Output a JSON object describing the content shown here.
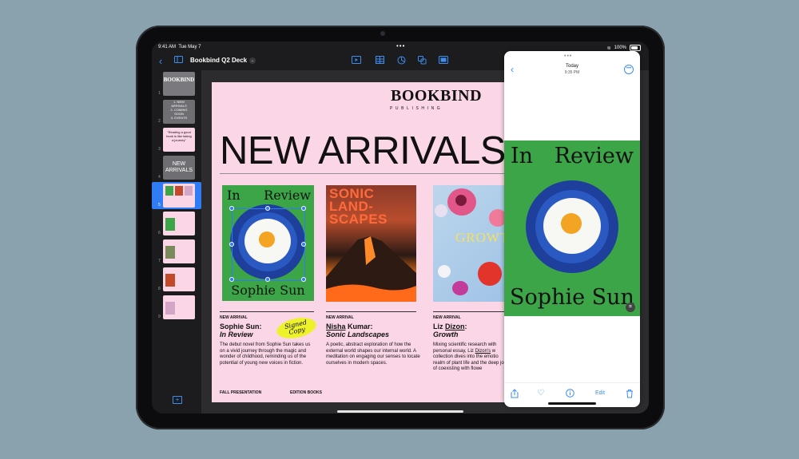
{
  "status_bar": {
    "time": "9:41 AM",
    "date": "Tue May 7",
    "more": "•••",
    "battery": "100%"
  },
  "toolbar": {
    "back": "‹",
    "document_title": "Bookbind Q2 Deck"
  },
  "navigator": {
    "slide_numbers": [
      "1",
      "2",
      "3",
      "4",
      "5",
      "6",
      "7",
      "8",
      "9"
    ],
    "thumb2": "1. NEW\nARRIVALS\n2. COMING\nSOON\n3. EVENTS",
    "thumb3": "\"Reading a good book is like taking a journey\"",
    "thumb4": "NEW ARRIVALS"
  },
  "slide": {
    "logo": "BOOKBIND",
    "logo_sub": "PUBLISHING",
    "headline": "NEW ARRIVALS",
    "cover1": {
      "title_left": "In",
      "title_right": "Review",
      "author": "Sophie Sun"
    },
    "cover2": {
      "text": "SONIC\nLAND-\nSCAPES"
    },
    "cover3": {
      "text": "GROWTH"
    },
    "col1": {
      "tag": "NEW ARRIVAL",
      "name": "Sophie Sun:",
      "title": "In Review",
      "desc": "The debut novel from Sophie Sun takes us on a vivid journey through the magic and wonder of childhood, reminding us of the potential of young new voices in fiction."
    },
    "col2": {
      "tag": "NEW ARRIVAL",
      "name_a": "Nisha",
      "name_b": " Kumar:",
      "title": "Sonic Landscapes",
      "desc": "A poetic, abstract exploration of how the external world shapes our internal world. A meditation on engaging our senses to locate ourselves in modern spaces."
    },
    "col3": {
      "tag": "NEW ARRIVAL",
      "name_a": "Liz ",
      "name_b": "Dizon",
      "name_c": ":",
      "title": "Growth",
      "desc_a": "Mixing scientific research with personal essay, Liz ",
      "desc_b": "Dizon's",
      "desc_c": " w collection dives into the emotio realm of plant life and the deep joy of coexisting with flowe"
    },
    "sticker": "Signed\nCopy",
    "footer_left": "FALL PRESENTATION",
    "footer_mid": "EDITION BOOKS"
  },
  "panel": {
    "handle": "•••",
    "date": "Today",
    "time": "9:35 PM",
    "image": {
      "title_left": "In",
      "title_right": "Review",
      "author": "Sophie Sun"
    },
    "edit_label": "Edit"
  },
  "colors": {
    "accent": "#2f7cf6",
    "slide_bg": "#fbd6e7",
    "cover_green": "#3ca548",
    "plate_blue": "#1f3f9c"
  },
  "icons": [
    "back-chevron-icon",
    "sidebar-icon",
    "play-icon",
    "table-icon",
    "chart-icon",
    "shapes-icon",
    "media-icon",
    "share-icon",
    "heart-icon",
    "info-icon",
    "trash-icon",
    "add-slide-icon",
    "more-icon",
    "live-text-icon"
  ]
}
